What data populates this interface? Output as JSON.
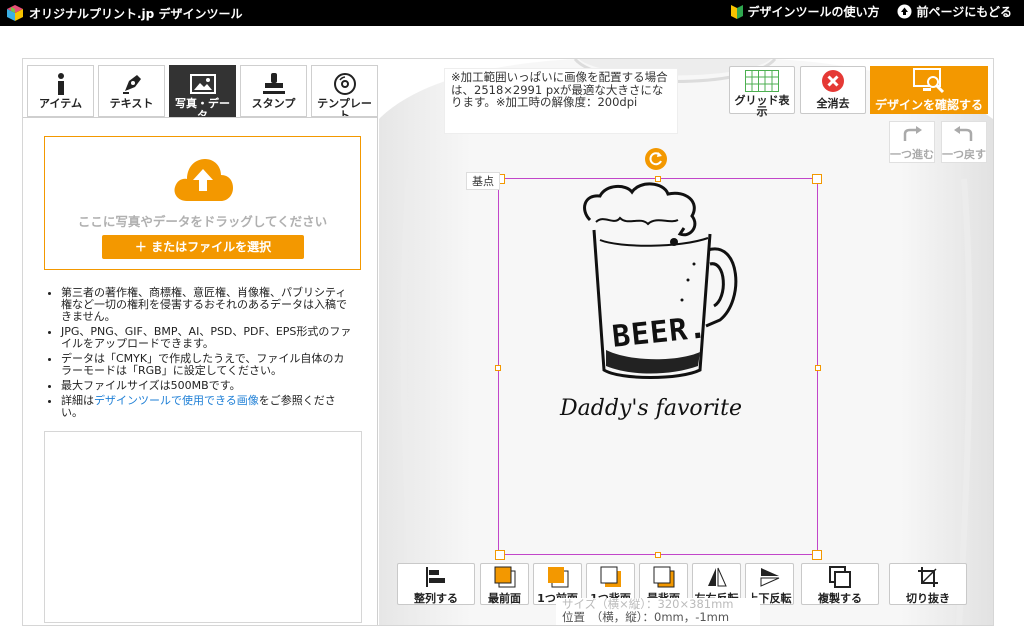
{
  "header": {
    "logo_text": "オリジナルプリント.jp デザインツール",
    "links": {
      "howto": "デザインツールの使い方",
      "back": "前ページにもどる"
    }
  },
  "tabs": [
    {
      "label": "アイテム",
      "icon": "info-icon"
    },
    {
      "label": "テキスト",
      "icon": "pen-icon"
    },
    {
      "label": "写真・デー タ",
      "icon": "image-icon",
      "active": true
    },
    {
      "label": "スタンプ",
      "icon": "stamp-icon"
    },
    {
      "label": "テンプレー ト",
      "icon": "disc-icon"
    }
  ],
  "upload": {
    "drop_text": "ここに写真やデータをドラッグしてください",
    "file_button": "＋ またはファイルを選択"
  },
  "notes": {
    "n1": "第三者の著作権、商標権、意匠権、肖像権、パブリシティ権など一切の権利を侵害するおそれのあるデータは入稿できません。",
    "n2": "JPG、PNG、GIF、BMP、AI、PSD、PDF、EPS形式のファイルをアップロードできます。",
    "n3": "データは「CMYK」で作成したうえで、ファイル自体のカラーモードは「RGB」に設定してください。",
    "n4": "最大ファイルサイズは500MBです。",
    "n5_pre": "詳細は",
    "n5_link": "デザインツールで使用できる画像",
    "n5_post": "をご参照ください。"
  },
  "canvas": {
    "info_text": "※加工範囲いっぱいに画像を配置する場合は、2518×2991 pxが最適な大きさになります。※加工時の解像度：200dpi",
    "base_label": "基点",
    "design_text": [
      "BEER.",
      "Daddy's favorite"
    ]
  },
  "toolbar_top": {
    "grid": "グリッド表示",
    "clear": "全消去",
    "confirm": "デザインを確認する",
    "redo": "一つ進む",
    "undo": "一つ戻す"
  },
  "toolbar_bottom": [
    {
      "label": "整列する",
      "icon": "align-icon"
    },
    {
      "label": "最前面",
      "icon": "bring-front-icon"
    },
    {
      "label": "1つ前面",
      "icon": "bring-forward-icon"
    },
    {
      "label": "1つ背面",
      "icon": "send-backward-icon"
    },
    {
      "label": "最背面",
      "icon": "send-back-icon"
    },
    {
      "label": "左右反転",
      "icon": "flip-h-icon"
    },
    {
      "label": "上下反転",
      "icon": "flip-v-icon"
    },
    {
      "label": "複製する",
      "icon": "duplicate-icon"
    },
    {
      "label": "切り抜き",
      "icon": "crop-icon"
    }
  ],
  "status": {
    "size": "サイズ（横×縦）：320×381mm",
    "position": "位置　（横，縦）：0mm，-1mm"
  },
  "colors": {
    "accent": "#f39800",
    "frame": "#c146c9",
    "topbar": "#000000"
  }
}
